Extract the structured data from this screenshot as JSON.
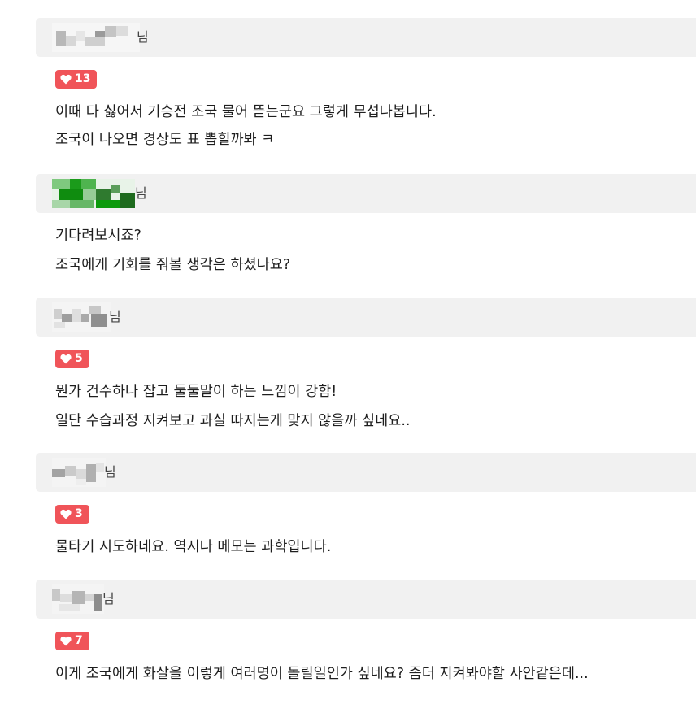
{
  "name_suffix": "님",
  "comments": [
    {
      "author_suffix": "님",
      "likes": "13",
      "lines": [
        "이때 다 싫어서 기승전 조국 물어 뜯는군요 그렇게 무섭나봅니다.",
        "조국이 나오면 경상도 표 뽑힐까봐 ㅋ"
      ]
    },
    {
      "author_suffix": "님",
      "likes": null,
      "lines": [
        "기다려보시죠?",
        "조국에게 기회를 줘볼 생각은 하셨나요?"
      ]
    },
    {
      "author_suffix": "님",
      "likes": "5",
      "lines": [
        "뭔가 건수하나 잡고 둘둘말이 하는 느낌이 강함!",
        "일단 수습과정 지켜보고 과실 따지는게 맞지 않을까 싶네요.."
      ]
    },
    {
      "author_suffix": "님",
      "likes": "3",
      "lines": [
        "물타기 시도하네요. 역시나 메모는 과학입니다."
      ]
    },
    {
      "author_suffix": "님",
      "likes": "7",
      "lines": [
        "이게 조국에게 화살을 이렇게 여러명이 돌릴일인가 싶네요? 좀더 지켜봐야할 사안같은데..."
      ]
    }
  ],
  "colors": {
    "author_bar_bg": "#f1f1f1",
    "like_badge_bg": "#f05459",
    "text": "#1e1e1e"
  },
  "icons": {
    "like": "heart-icon"
  }
}
